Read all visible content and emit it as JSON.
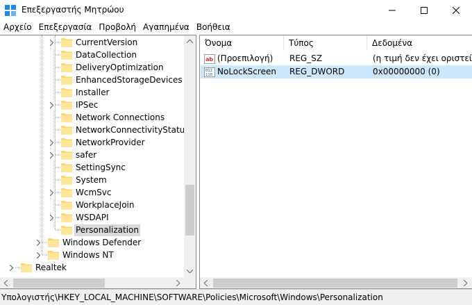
{
  "window": {
    "title": "Επεξεργαστής Μητρώου",
    "app_icon": "regedit-icon",
    "controls": [
      "minimize-icon",
      "maximize-icon",
      "close-icon"
    ]
  },
  "menu": {
    "items": [
      "Αρχείο",
      "Επεξεργασία",
      "Προβολή",
      "Αγαπημένα",
      "Βοήθεια"
    ]
  },
  "tree": {
    "items": [
      {
        "label": "CurrentVersion",
        "expandable": true,
        "selected": false
      },
      {
        "label": "DataCollection",
        "expandable": false,
        "selected": false
      },
      {
        "label": "DeliveryOptimization",
        "expandable": false,
        "selected": false
      },
      {
        "label": "EnhancedStorageDevices",
        "expandable": false,
        "selected": false
      },
      {
        "label": "Installer",
        "expandable": false,
        "selected": false
      },
      {
        "label": "IPSec",
        "expandable": true,
        "selected": false
      },
      {
        "label": "Network Connections",
        "expandable": false,
        "selected": false
      },
      {
        "label": "NetworkConnectivityStatusInd",
        "expandable": false,
        "selected": false
      },
      {
        "label": "NetworkProvider",
        "expandable": true,
        "selected": false
      },
      {
        "label": "safer",
        "expandable": true,
        "selected": false
      },
      {
        "label": "SettingSync",
        "expandable": false,
        "selected": false
      },
      {
        "label": "System",
        "expandable": false,
        "selected": false
      },
      {
        "label": "WcmSvc",
        "expandable": true,
        "selected": false
      },
      {
        "label": "WorkplaceJoin",
        "expandable": false,
        "selected": false
      },
      {
        "label": "WSDAPI",
        "expandable": true,
        "selected": false
      },
      {
        "label": "Personalization",
        "expandable": false,
        "selected": true
      },
      {
        "label": "Windows Defender",
        "expandable": true,
        "selected": false
      },
      {
        "label": "Windows NT",
        "expandable": true,
        "selected": false
      },
      {
        "label": "Realtek",
        "expandable": true,
        "selected": false
      }
    ]
  },
  "list": {
    "columns": [
      "Όνομα",
      "Τύπος",
      "Δεδομένα"
    ],
    "rows": [
      {
        "icon": "string-value-icon",
        "name": "(Προεπιλογή)",
        "type": "REG_SZ",
        "data": "(η τιμή δεν έχει οριστεί)",
        "selected": false
      },
      {
        "icon": "binary-value-icon",
        "name": "NoLockScreen",
        "type": "REG_DWORD",
        "data": "0x00000000 (0)",
        "selected": true
      }
    ]
  },
  "status": {
    "path": "Υπολογιστής\\HKEY_LOCAL_MACHINE\\SOFTWARE\\Policies\\Microsoft\\Windows\\Personalization"
  },
  "colors": {
    "selection_row": "#cce8ff",
    "tree_selection": "#d9d9d9",
    "folder": "#ffd766",
    "scroll_thumb": "#cdcdcd"
  }
}
